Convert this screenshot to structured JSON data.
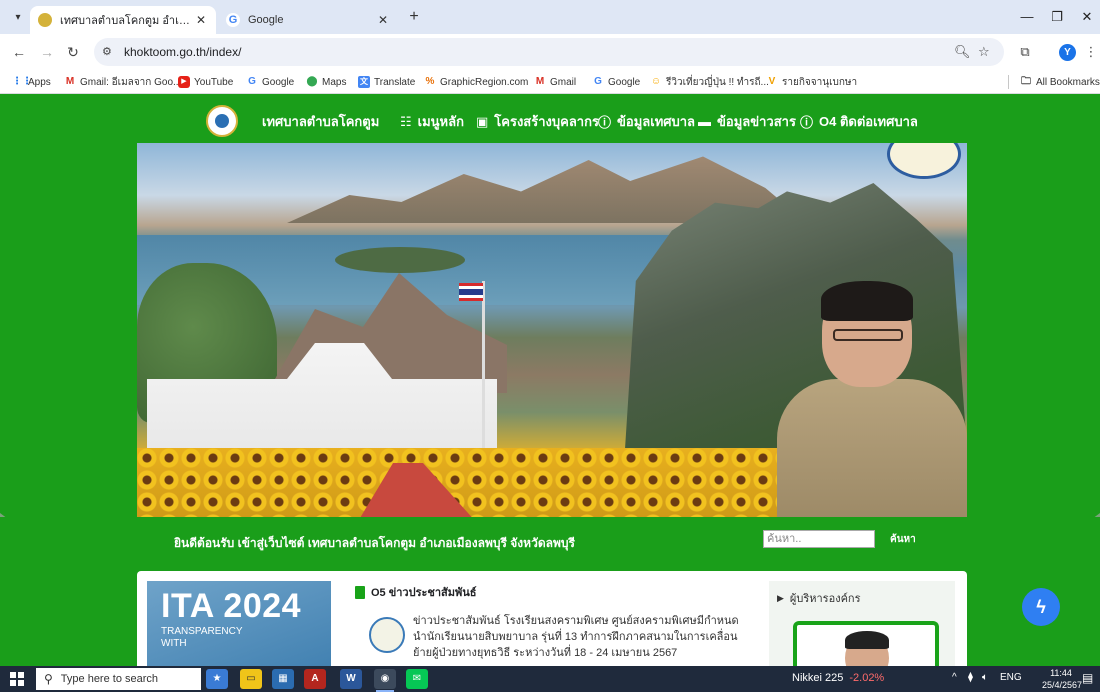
{
  "browser": {
    "tabs": [
      {
        "title": "เทศบาลตำบลโคกตูม อำเภอเมืองลพบุรี",
        "active": true
      },
      {
        "title": "Google",
        "active": false
      }
    ],
    "new_tab": "+",
    "url": "khoktoom.go.th/index/",
    "profile_initial": "Y",
    "bookmarks": [
      {
        "label": "Apps",
        "icon": "apps-icon"
      },
      {
        "label": "Gmail: อีเมลจาก Goo...",
        "icon": "gmail-icon"
      },
      {
        "label": "YouTube",
        "icon": "youtube-icon"
      },
      {
        "label": "Google",
        "icon": "google-icon"
      },
      {
        "label": "Maps",
        "icon": "maps-icon"
      },
      {
        "label": "Translate",
        "icon": "translate-icon"
      },
      {
        "label": "GraphicRegion.com",
        "icon": "graphicregion-icon"
      },
      {
        "label": "Gmail",
        "icon": "gmail-icon"
      },
      {
        "label": "Google",
        "icon": "google-icon"
      },
      {
        "label": "รีวิวเที่ยวญี่ปุ่น !! ทำรถี...",
        "icon": "smile-icon"
      },
      {
        "label": "รายกิจจานุเบกษา",
        "icon": "v-icon"
      }
    ],
    "all_bookmarks": "All Bookmarks"
  },
  "site": {
    "name": "เทศบาลตำบลโคกตูม",
    "nav": [
      {
        "label": "เมนูหลัก",
        "icon": "grid-icon"
      },
      {
        "label": "โครงสร้างบุคลากร",
        "icon": "calendar-icon"
      },
      {
        "label": "ข้อมูลเทศบาล",
        "icon": "info-icon"
      },
      {
        "label": "ข้อมูลข่าวสาร",
        "icon": "chat-icon"
      },
      {
        "label": "O4 ติดต่อเทศบาล",
        "icon": "info-circle-icon"
      }
    ],
    "welcome": "ยินดีต้อนรับ เข้าสู่เว็บไซต์ เทศบาลตำบลโคกตูม อำเภอเมืองลพบุรี จังหวัดลพบุรี",
    "search_placeholder": "ค้นหา..",
    "search_button": "ค้นหา"
  },
  "ita": {
    "title": "ITA 2024",
    "line1": "TRANSPARENCY",
    "line2": "WITH"
  },
  "news": {
    "heading": "O5 ข่าวประชาสัมพันธ์",
    "text": "ข่าวประชาสัมพันธ์ โรงเรียนสงครามพิเศษ ศูนย์สงครามพิเศษมีกำหนด นำนักเรียนนายสิบพยาบาล รุ่นที่ 13 ทำการฝึกภาคสนามในการเคลื่อนย้ายผู้ป่วยทางยุทธวิธี ระหว่างวันที่ 18 - 24 เมษายน 2567"
  },
  "admin": {
    "title": "ผู้บริหารองค์กร"
  },
  "taskbar": {
    "search_placeholder": "Type here to search",
    "stock_name": "Nikkei 225",
    "stock_change": "-2.02%",
    "lang": "ENG",
    "time": "11:44",
    "date": "25/4/2567"
  },
  "colors": {
    "site_green": "#1a9e1a",
    "chrome_tab_bg": "#dfe7f5",
    "taskbar_bg": "#1f2a3c",
    "stock_negative": "#ff6b6b",
    "messenger_blue": "#2f7ff2"
  }
}
